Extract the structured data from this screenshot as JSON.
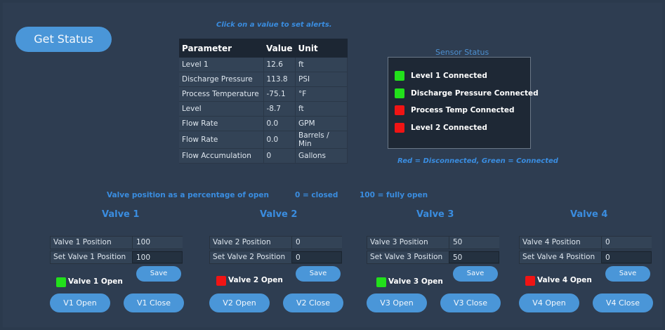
{
  "get_status_label": "Get Status",
  "hint_top": "Click on a value to set alerts.",
  "table": {
    "headers": [
      "Parameter",
      "Value",
      "Unit"
    ],
    "rows": [
      [
        "Level 1",
        "12.6",
        "ft"
      ],
      [
        "Discharge Pressure",
        "113.8",
        "PSI"
      ],
      [
        "Process Temperature",
        "-75.1",
        "°F"
      ],
      [
        "Level",
        "-8.7",
        "ft"
      ],
      [
        "Flow Rate",
        "0.0",
        "GPM"
      ],
      [
        "Flow Rate",
        "0.0",
        "Barrels / Min"
      ],
      [
        "Flow Accumulation",
        "0",
        "Gallons"
      ]
    ]
  },
  "sensor": {
    "title": "Sensor Status",
    "items": [
      {
        "label": "Level 1 Connected",
        "color": "#22e01b"
      },
      {
        "label": "Discharge Pressure Connected",
        "color": "#22e01b"
      },
      {
        "label": "Process Temp Connected",
        "color": "#f01414"
      },
      {
        "label": "Level 2 Connected",
        "color": "#f01414"
      }
    ],
    "legend": "Red = Disconnected, Green = Connected"
  },
  "valve_legend": {
    "text1": "Valve position as a percentage of open",
    "text2": "0 = closed",
    "text3": "100 = fully open"
  },
  "valves": [
    {
      "title": "Valve 1",
      "pos_label": "Valve 1 Position",
      "pos_value": "100",
      "set_label": "Set Valve 1 Position",
      "set_value": "100",
      "save": "Save",
      "status": "Valve 1 Open",
      "status_color": "#22e01b",
      "open": "V1 Open",
      "close": "V1 Close"
    },
    {
      "title": "Valve 2",
      "pos_label": "Valve 2 Position",
      "pos_value": "0",
      "set_label": "Set Valve 2 Position",
      "set_value": "0",
      "save": "Save",
      "status": "Valve 2 Open",
      "status_color": "#f01414",
      "open": "V2 Open",
      "close": "V2 Close"
    },
    {
      "title": "Valve 3",
      "pos_label": "Valve 3 Position",
      "pos_value": "50",
      "set_label": "Set Valve 3 Position",
      "set_value": "50",
      "save": "Save",
      "status": "Valve 3 Open",
      "status_color": "#22e01b",
      "open": "V3 Open",
      "close": "V3 Close"
    },
    {
      "title": "Valve 4",
      "pos_label": "Valve 4 Position",
      "pos_value": "0",
      "set_label": "Set Valve 4 Position",
      "set_value": "0",
      "save": "Save",
      "status": "Valve 4 Open",
      "status_color": "#f01414",
      "open": "V4 Open",
      "close": "V4 Close"
    }
  ]
}
